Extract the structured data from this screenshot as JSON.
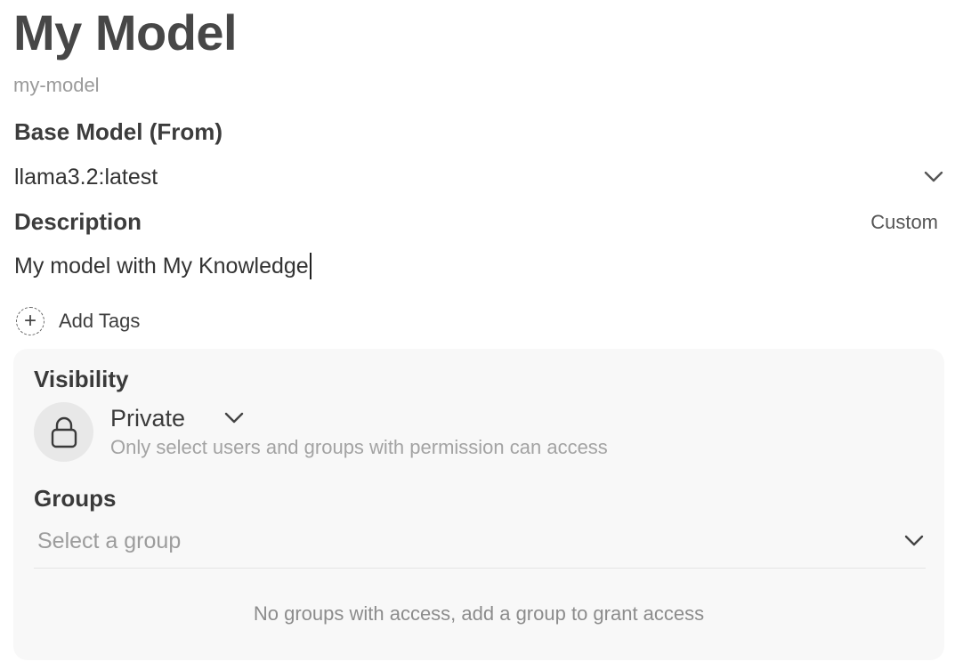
{
  "model": {
    "name": "My Model",
    "id": "my-model"
  },
  "base_model": {
    "label": "Base Model (From)",
    "value": "llama3.2:latest",
    "chevron_icon": "chevron-down-icon"
  },
  "description": {
    "label": "Description",
    "mode_toggle": "Custom",
    "value": "My model with My Knowledge"
  },
  "tags": {
    "add_label": "Add Tags",
    "icon": "plus-circle-icon"
  },
  "access": {
    "visibility_label": "Visibility",
    "visibility_value": "Private",
    "visibility_description": "Only select users and groups with permission can access",
    "lock_icon": "lock-icon",
    "groups_label": "Groups",
    "groups_placeholder": "Select a group",
    "empty_message": "No groups with access, add a group to grant access"
  },
  "colors": {
    "card_background": "#f8f8f8",
    "lock_circle_background": "#e8e8e8",
    "muted_text": "#9a9a9a"
  }
}
